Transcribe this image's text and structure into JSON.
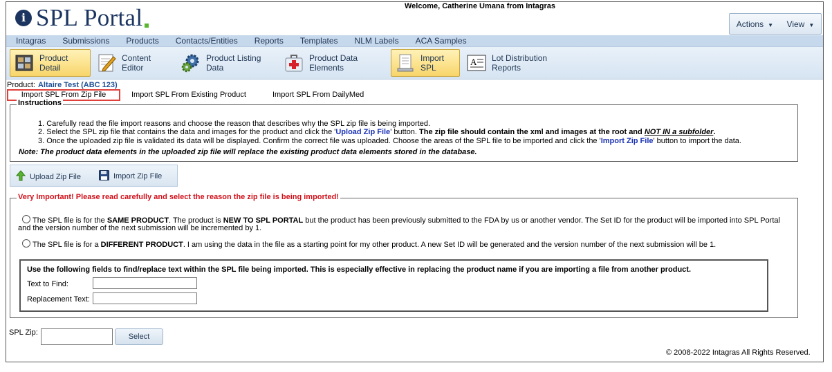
{
  "header": {
    "logo_text": "SPL Portal",
    "welcome": "Welcome, Catherine Umana from Intagras",
    "actions_label": "Actions",
    "view_label": "View"
  },
  "menu": [
    "Intagras",
    "Submissions",
    "Products",
    "Contacts/Entities",
    "Reports",
    "Templates",
    "NLM Labels",
    "ACA Samples"
  ],
  "toolbar": {
    "items": [
      {
        "label": "Product Detail",
        "icon": "product-detail-icon",
        "active": true
      },
      {
        "label": "Content Editor",
        "icon": "pencil-icon",
        "active": false
      },
      {
        "label": "Product Listing Data",
        "icon": "gear-icon",
        "active": false
      },
      {
        "label": "Product Data Elements",
        "icon": "medical-kit-icon",
        "active": false
      },
      {
        "label": "Import SPL",
        "icon": "import-document-icon",
        "active": true
      },
      {
        "label": "Lot Distribution Reports",
        "icon": "report-icon",
        "active": false
      }
    ]
  },
  "product": {
    "label": "Product:",
    "value": "Altaire Test (ABC 123)"
  },
  "subtabs": [
    "Import SPL From Zip File",
    "Import SPL From Existing Product",
    "Import SPL From DailyMed"
  ],
  "instructions": {
    "title": "Instructions",
    "step1": "1. Carefully read the file import reasons and choose the reason that describes why the SPL zip file is being imported.",
    "step2_a": "2. Select the SPL zip file that contains the data and images for the product and click the '",
    "step2_link": "Upload Zip File",
    "step2_b": "' button. ",
    "step2_bold": "The zip file should contain the xml and images at the root and ",
    "step2_emph": "NOT IN a subfolder",
    "step2_end": ".",
    "step3_a": "3. Once the uploaded zip file is validated its data will be displayed. Confirm the correct file was uploaded. Choose the areas of the SPL file to be imported and click the '",
    "step3_link": "Import Zip File",
    "step3_b": "' button to import the data.",
    "note": "Note: The product data elements in the uploaded zip file will replace the existing product data elements stored in the database."
  },
  "actions": {
    "upload": "Upload Zip File",
    "import": "Import Zip File"
  },
  "reasons": {
    "title": "Very Important! Please read carefully and select the reason the zip file is being imported!",
    "opt1_a": "The SPL file is for the ",
    "opt1_bold1": "SAME PRODUCT",
    "opt1_b": ". The product is ",
    "opt1_bold2": "NEW TO SPL PORTAL",
    "opt1_c": " but the product has been previously submitted to the FDA by us or another vendor. The Set ID for the product will be imported into SPL Portal",
    "opt1_d": "and the version number of the next submission will be incremented by 1.",
    "opt2_a": "The SPL file is for a ",
    "opt2_bold": "DIFFERENT PRODUCT",
    "opt2_b": ". I am using the data in the file as a starting point for my other product. A new Set ID will be generated and the version number of the next submission will be 1."
  },
  "findreplace": {
    "title": "Use the following fields to find/replace text within the SPL file being imported. This is especially effective in replacing the product name if you are importing a file from another product.",
    "find_label": "Text to Find:",
    "replace_label": "Replacement Text:"
  },
  "splzip": {
    "label": "SPL Zip:",
    "select_label": "Select"
  },
  "footer": {
    "copyright": "© 2008-2022 Intagras All Rights Reserved."
  }
}
